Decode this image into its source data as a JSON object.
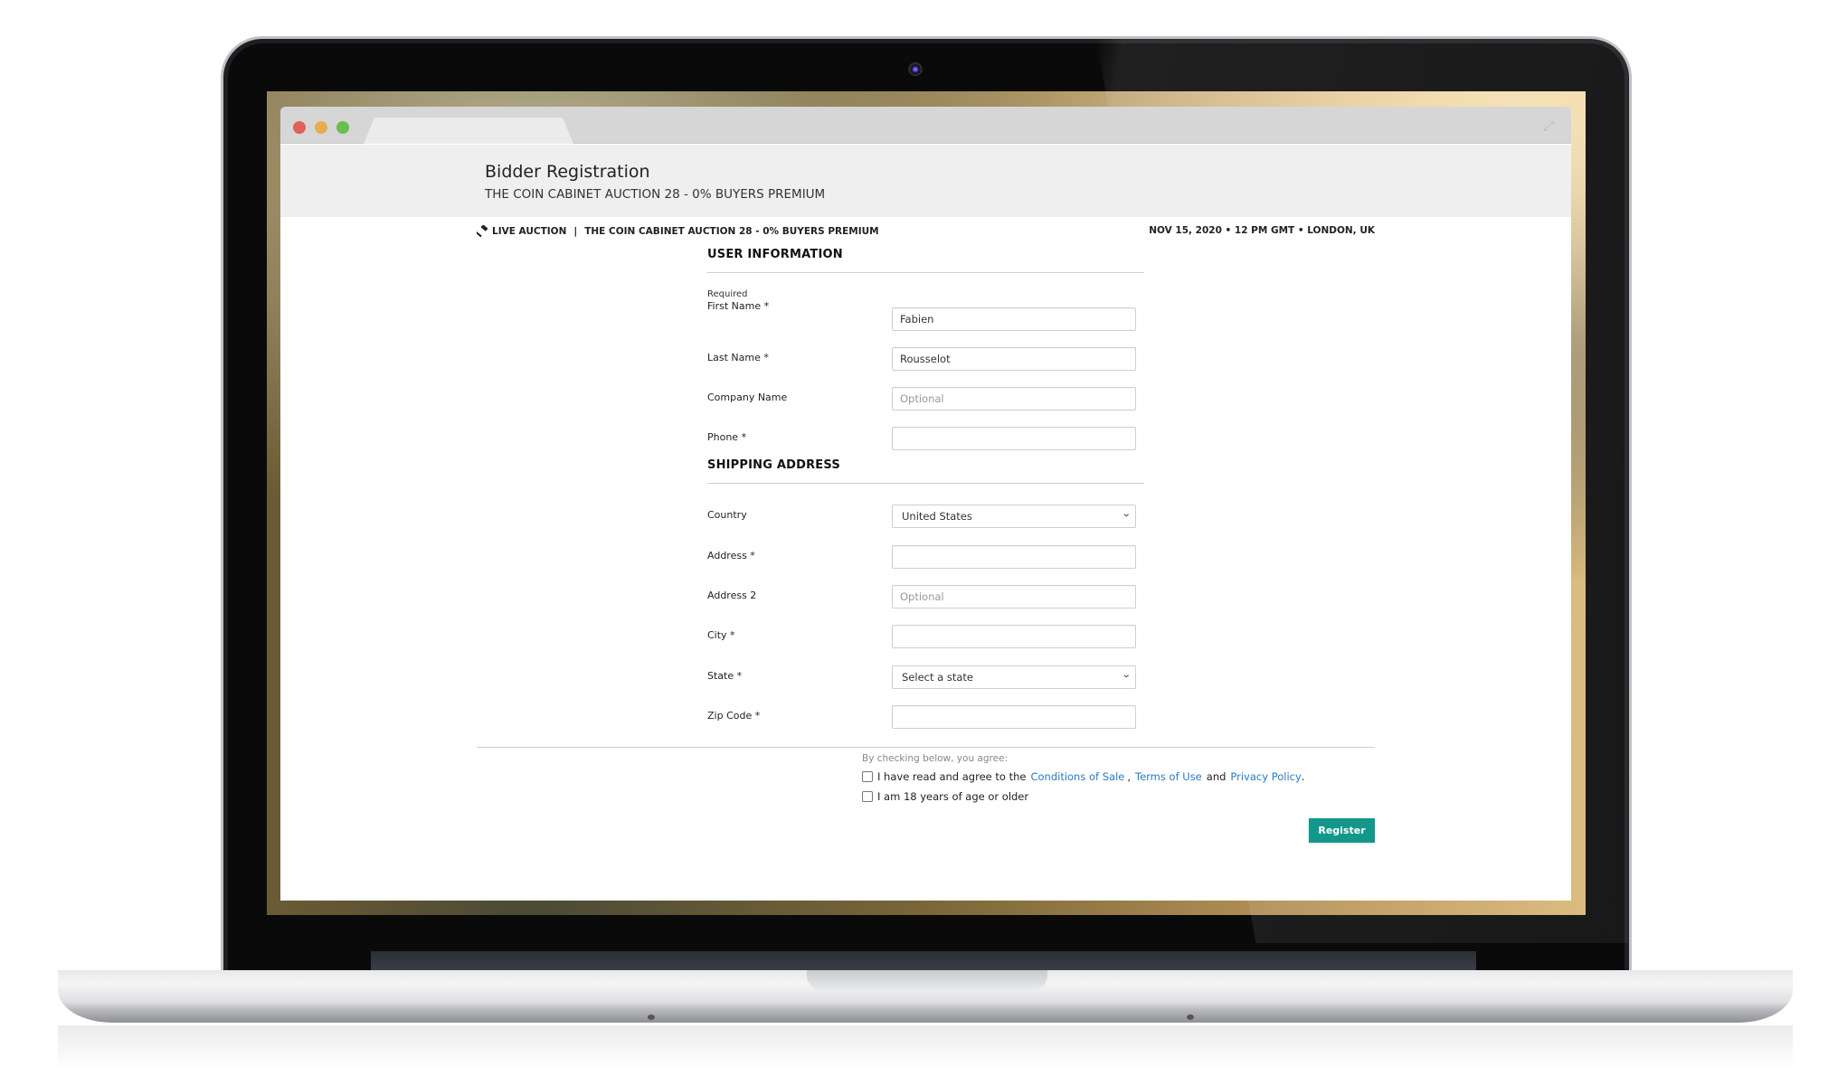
{
  "browser": {
    "window_controls": [
      "close",
      "minimize",
      "maximize"
    ],
    "expand_icon": "expand-icon"
  },
  "header": {
    "title": "Bidder Registration",
    "subtitle": "THE COIN CABINET AUCTION 28 - 0% BUYERS PREMIUM"
  },
  "info_bar": {
    "icon": "gavel-icon",
    "type": "LIVE AUCTION",
    "separator": "|",
    "auction_name": "THE COIN CABINET AUCTION 28 - 0% BUYERS PREMIUM",
    "date_location": "NOV 15, 2020 • 12 PM GMT • LONDON, UK"
  },
  "user_information": {
    "title": "USER INFORMATION",
    "required_note": "Required",
    "fields": [
      {
        "label": "First Name *",
        "value": "Fabien",
        "placeholder": ""
      },
      {
        "label": "Last Name *",
        "value": "Rousselot",
        "placeholder": ""
      },
      {
        "label": "Company Name",
        "value": "",
        "placeholder": "Optional"
      },
      {
        "label": "Phone *",
        "value": "",
        "placeholder": ""
      }
    ]
  },
  "shipping_address": {
    "title": "SHIPPING ADDRESS",
    "country": {
      "label": "Country",
      "selected": "United States"
    },
    "address": {
      "label": "Address *",
      "value": "",
      "placeholder": ""
    },
    "address2": {
      "label": "Address 2",
      "value": "",
      "placeholder": "Optional"
    },
    "city": {
      "label": "City *",
      "value": "",
      "placeholder": ""
    },
    "state": {
      "label": "State *",
      "selected": "Select a state"
    },
    "zip": {
      "label": "Zip Code *",
      "value": "",
      "placeholder": ""
    }
  },
  "agreement": {
    "intro": "By checking below, you agree:",
    "terms": {
      "prefix": "I have read and agree to the",
      "conditions_link": "Conditions of Sale",
      "comma": ",",
      "terms_link": "Terms of Use",
      "and": "and",
      "privacy_link": "Privacy Policy",
      "suffix": ".",
      "checked": false
    },
    "age": {
      "label": "I am 18 years of age or older",
      "checked": false
    }
  },
  "actions": {
    "register_label": "Register"
  },
  "colors": {
    "accent": "#13978a",
    "link": "#2a7ac0",
    "header_band": "#efefef",
    "tabbar": "#d6d6d6"
  }
}
